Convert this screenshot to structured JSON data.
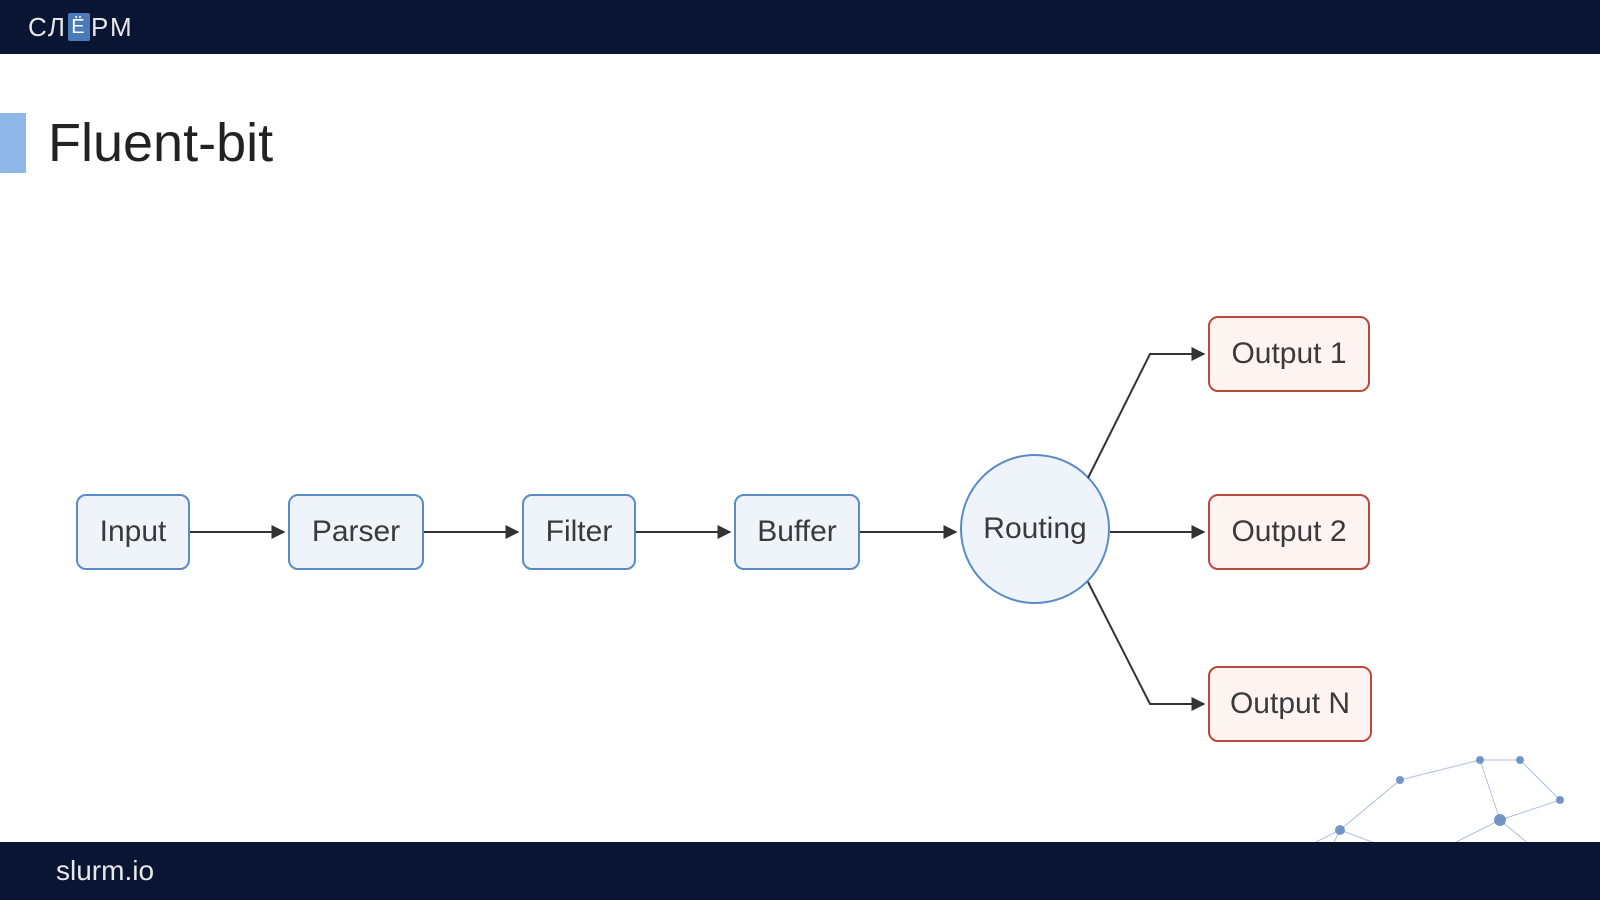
{
  "brand": {
    "logo_prefix": "СЛ",
    "logo_highlight": "Ё",
    "logo_suffix": "РМ"
  },
  "title": "Fluent-bit",
  "nodes": {
    "input": "Input",
    "parser": "Parser",
    "filter": "Filter",
    "buffer": "Buffer",
    "routing": "Routing",
    "output1": "Output 1",
    "output2": "Output 2",
    "outputN": "Output N"
  },
  "footer": {
    "url": "slurm.io"
  },
  "colors": {
    "header_bg": "#0a1433",
    "box_border": "#5a8bc4",
    "box_fill": "#eef4fa",
    "output_border": "#b94a3a",
    "output_fill": "#fdf3f1",
    "accent": "#4a7ab8"
  }
}
